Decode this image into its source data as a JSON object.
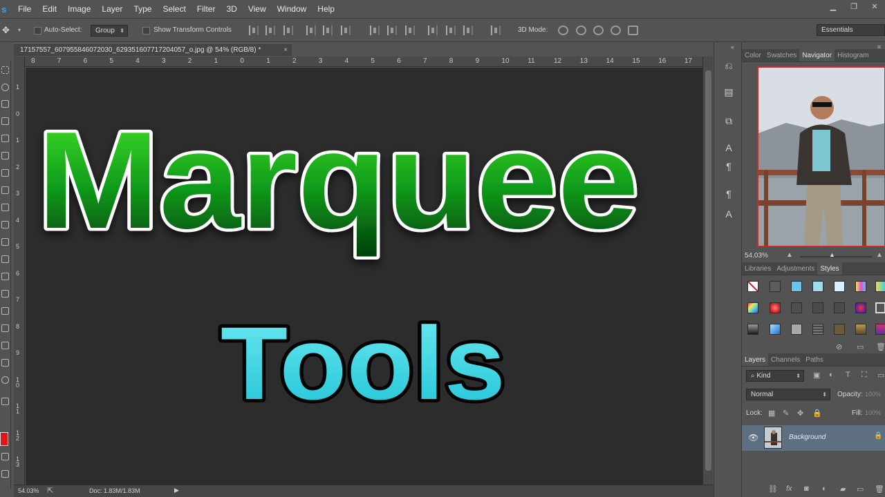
{
  "app": {
    "logo": "s"
  },
  "menu": [
    "File",
    "Edit",
    "Image",
    "Layer",
    "Type",
    "Select",
    "Filter",
    "3D",
    "View",
    "Window",
    "Help"
  ],
  "window_buttons": {
    "minimize": "▁",
    "restore": "❐",
    "close": "✕"
  },
  "options": {
    "auto_select_label": "Auto-Select:",
    "auto_select_value": "Group",
    "show_transform_label": "Show Transform Controls",
    "mode_3d_label": "3D Mode:",
    "workspace": "Essentials"
  },
  "document": {
    "tab_title": "17157557_607955846072030_6293516077172040​57_o.jpg @ 54% (RGB/8) *",
    "close": "×",
    "hruler_labels": [
      "8",
      "7",
      "6",
      "5",
      "4",
      "3",
      "2",
      "1",
      "0",
      "1",
      "2",
      "3",
      "4",
      "5",
      "6",
      "7",
      "8",
      "9",
      "10",
      "11",
      "12",
      "13",
      "14",
      "15",
      "16",
      "17"
    ],
    "vruler_labels": [
      "1",
      "0",
      "1",
      "2",
      "3",
      "4",
      "5",
      "6",
      "7",
      "8",
      "9",
      "1\n0",
      "1\n1",
      "1\n2",
      "1\n3"
    ],
    "headline": "Marquee",
    "subline": "Tools"
  },
  "status": {
    "zoom": "54.03%",
    "doc": "Doc: 1.83M/1.83M",
    "arrow": "▶"
  },
  "panels": {
    "top_tabs": [
      "Color",
      "Swatches",
      "Navigator",
      "Histogram"
    ],
    "navigator_zoom": "54.03%",
    "mid_tabs": [
      "Libraries",
      "Adjustments",
      "Styles"
    ],
    "layer_tabs": [
      "Layers",
      "Channels",
      "Paths"
    ],
    "kind_filter": "Kind",
    "blend_mode": "Normal",
    "opacity_label": "Opacity:",
    "opacity_value": "100%",
    "lock_label": "Lock:",
    "fill_label": "Fill:",
    "fill_value": "100%",
    "layer_name": "Background"
  },
  "colors": {
    "foreground": "#e11616",
    "accent_blue": "#31a8ff",
    "headline_top": "#46e628",
    "headline_bottom": "#003f0c",
    "subline": "#36d6e6",
    "layer_selected": "#5e6f82"
  },
  "icons": {
    "move": "move-tool-icon",
    "eye": "visibility-eye-icon",
    "lock": "lock-icon"
  }
}
